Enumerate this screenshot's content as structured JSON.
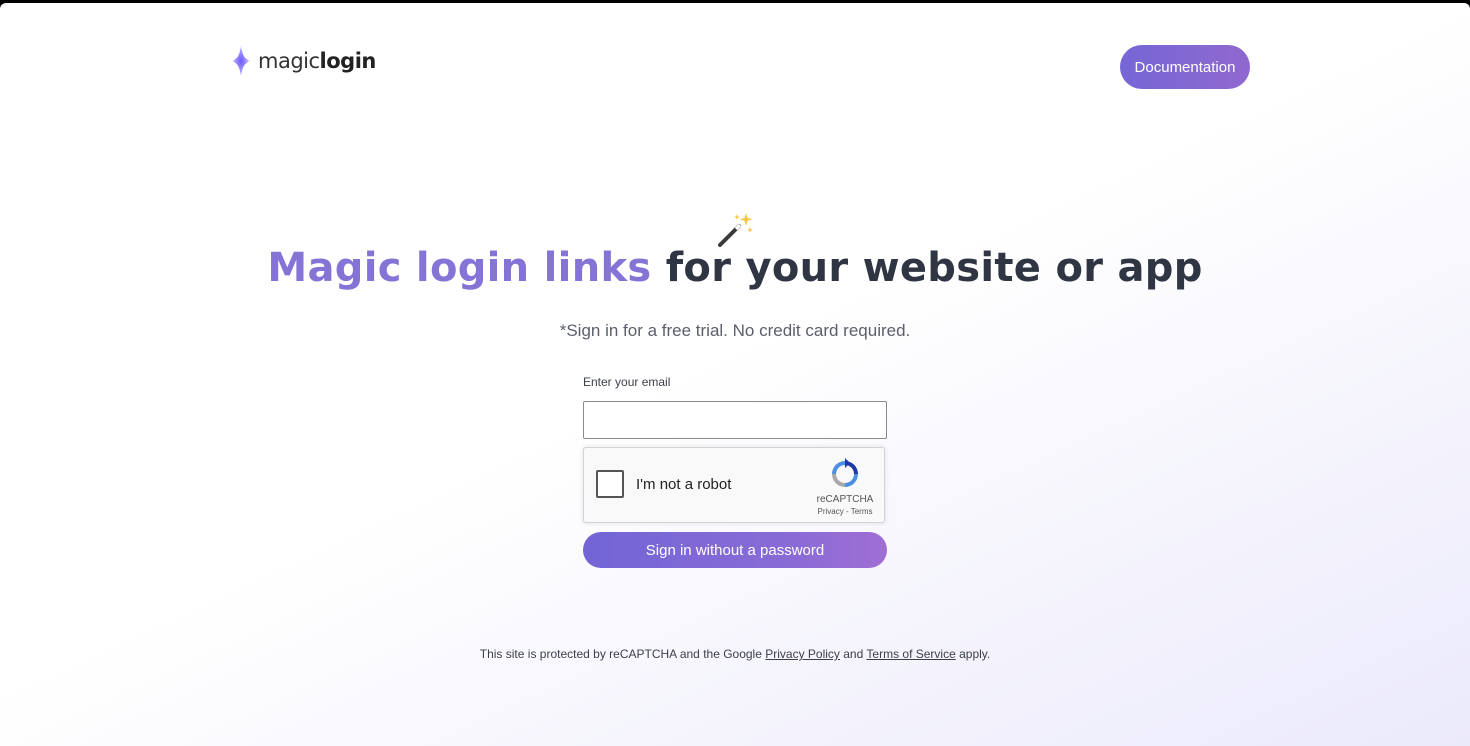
{
  "logo": {
    "text_light": "magic",
    "text_bold": "login",
    "icon": "sparkle-icon"
  },
  "header": {
    "documentation_label": "Documentation"
  },
  "hero": {
    "icon": "magic-wand-icon",
    "headline_accent": "Magic login links",
    "headline_rest": " for your website or app",
    "subtitle": "*Sign in for a free trial. No credit card required."
  },
  "form": {
    "email_label": "Enter your email",
    "email_value": "",
    "email_placeholder": "",
    "captcha_label": "I'm not a robot",
    "captcha_brand": "reCAPTCHA",
    "captcha_privacy": "Privacy",
    "captcha_separator": " - ",
    "captcha_terms": "Terms",
    "submit_label": "Sign in without a password"
  },
  "footer": {
    "prefix": "This site is protected by reCAPTCHA and the Google ",
    "privacy_link": "Privacy Policy",
    "middle": " and ",
    "terms_link": "Terms of Service",
    "suffix": " apply."
  },
  "colors": {
    "accent": "#8573d6",
    "button_start": "#7265d6",
    "button_end": "#a06ed3",
    "headline": "#2f3542"
  }
}
